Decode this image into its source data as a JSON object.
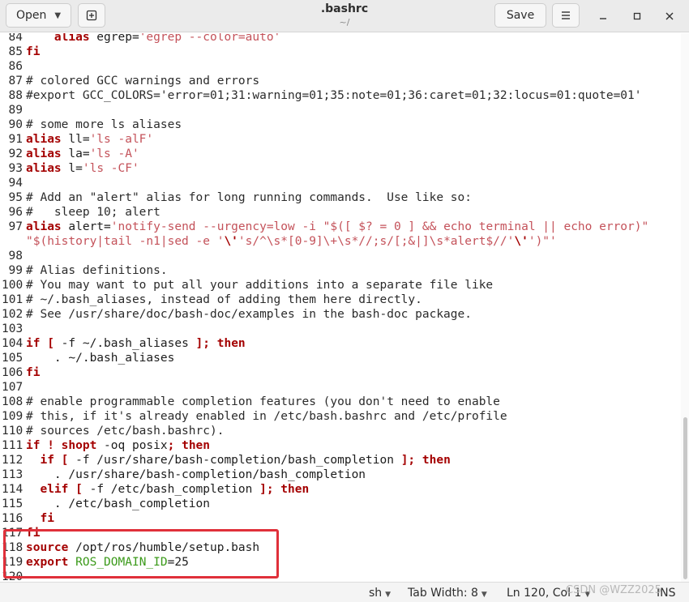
{
  "header": {
    "open_label": "Open",
    "save_label": "Save",
    "title": ".bashrc",
    "subtitle": "~/"
  },
  "editor": {
    "lines": [
      {
        "n": "84",
        "tokens": [
          {
            "t": "    "
          },
          {
            "t": "alias",
            "c": "kw"
          },
          {
            "t": " egrep="
          },
          {
            "t": "'egrep --color=auto'",
            "c": "str"
          }
        ]
      },
      {
        "n": "85",
        "tokens": [
          {
            "t": "fi",
            "c": "kw"
          }
        ]
      },
      {
        "n": "86",
        "tokens": []
      },
      {
        "n": "87",
        "tokens": [
          {
            "t": "# colored GCC warnings and errors",
            "c": "cmt"
          }
        ]
      },
      {
        "n": "88",
        "tokens": [
          {
            "t": "#export GCC_COLORS='error=01;31:warning=01;35:note=01;36:caret=01;32:locus=01:quote=01'",
            "c": "cmt"
          }
        ]
      },
      {
        "n": "89",
        "tokens": []
      },
      {
        "n": "90",
        "tokens": [
          {
            "t": "# some more ls aliases",
            "c": "cmt"
          }
        ]
      },
      {
        "n": "91",
        "tokens": [
          {
            "t": "alias",
            "c": "kw"
          },
          {
            "t": " ll="
          },
          {
            "t": "'ls -alF'",
            "c": "str"
          }
        ]
      },
      {
        "n": "92",
        "tokens": [
          {
            "t": "alias",
            "c": "kw"
          },
          {
            "t": " la="
          },
          {
            "t": "'ls -A'",
            "c": "str"
          }
        ]
      },
      {
        "n": "93",
        "tokens": [
          {
            "t": "alias",
            "c": "kw"
          },
          {
            "t": " l="
          },
          {
            "t": "'ls -CF'",
            "c": "str"
          }
        ]
      },
      {
        "n": "94",
        "tokens": []
      },
      {
        "n": "95",
        "tokens": [
          {
            "t": "# Add an \"alert\" alias for long running commands.  Use like so:",
            "c": "cmt"
          }
        ]
      },
      {
        "n": "96",
        "tokens": [
          {
            "t": "#   sleep 10; alert",
            "c": "cmt"
          }
        ]
      },
      {
        "n": "97",
        "tokens": [
          {
            "t": "alias",
            "c": "kw"
          },
          {
            "t": " alert="
          },
          {
            "t": "'notify-send --urgency=low -i \"$([ $? = 0 ] && echo terminal || echo error)\"",
            "c": "str"
          }
        ]
      },
      {
        "n": "",
        "tokens": [
          {
            "t": "\"$(history|tail -n1|sed -e '",
            "c": "str"
          },
          {
            "t": "\\'",
            "c": "kw"
          },
          {
            "t": "'s/^\\s*[0-9]\\+\\s*//;s/[;&|]\\s*alert$//'",
            "c": "str"
          },
          {
            "t": "\\'",
            "c": "kw"
          },
          {
            "t": "')\"'",
            "c": "str"
          }
        ]
      },
      {
        "n": "98",
        "tokens": []
      },
      {
        "n": "99",
        "tokens": [
          {
            "t": "# Alias definitions.",
            "c": "cmt"
          }
        ]
      },
      {
        "n": "100",
        "tokens": [
          {
            "t": "# You may want to put all your additions into a separate file like",
            "c": "cmt"
          }
        ]
      },
      {
        "n": "101",
        "tokens": [
          {
            "t": "# ~/.bash_aliases, instead of adding them here directly.",
            "c": "cmt"
          }
        ]
      },
      {
        "n": "102",
        "tokens": [
          {
            "t": "# See /usr/share/doc/bash-doc/examples in the bash-doc package.",
            "c": "cmt"
          }
        ]
      },
      {
        "n": "103",
        "tokens": []
      },
      {
        "n": "104",
        "tokens": [
          {
            "t": "if",
            "c": "kw"
          },
          {
            "t": " [ ",
            "c": "kw"
          },
          {
            "t": "-f ~/.bash_aliases "
          },
          {
            "t": "]; then",
            "c": "kw"
          }
        ]
      },
      {
        "n": "105",
        "tokens": [
          {
            "t": "    . ~/.bash_aliases"
          }
        ]
      },
      {
        "n": "106",
        "tokens": [
          {
            "t": "fi",
            "c": "kw"
          }
        ]
      },
      {
        "n": "107",
        "tokens": []
      },
      {
        "n": "108",
        "tokens": [
          {
            "t": "# enable programmable completion features (you don't need to enable",
            "c": "cmt"
          }
        ]
      },
      {
        "n": "109",
        "tokens": [
          {
            "t": "# this, if it's already enabled in /etc/bash.bashrc and /etc/profile",
            "c": "cmt"
          }
        ]
      },
      {
        "n": "110",
        "tokens": [
          {
            "t": "# sources /etc/bash.bashrc).",
            "c": "cmt"
          }
        ]
      },
      {
        "n": "111",
        "tokens": [
          {
            "t": "if ! shopt",
            "c": "kw"
          },
          {
            "t": " -oq posix"
          },
          {
            "t": "; then",
            "c": "kw"
          }
        ]
      },
      {
        "n": "112",
        "tokens": [
          {
            "t": "  "
          },
          {
            "t": "if [",
            "c": "kw"
          },
          {
            "t": " -f /usr/share/bash-completion/bash_completion "
          },
          {
            "t": "]; then",
            "c": "kw"
          }
        ]
      },
      {
        "n": "113",
        "tokens": [
          {
            "t": "    . /usr/share/bash-completion/bash_completion"
          }
        ]
      },
      {
        "n": "114",
        "tokens": [
          {
            "t": "  "
          },
          {
            "t": "elif [",
            "c": "kw"
          },
          {
            "t": " -f /etc/bash_completion "
          },
          {
            "t": "]; then",
            "c": "kw"
          }
        ]
      },
      {
        "n": "115",
        "tokens": [
          {
            "t": "    . /etc/bash_completion"
          }
        ]
      },
      {
        "n": "116",
        "tokens": [
          {
            "t": "  "
          },
          {
            "t": "fi",
            "c": "kw"
          }
        ]
      },
      {
        "n": "117",
        "tokens": [
          {
            "t": "fi",
            "c": "kw"
          }
        ]
      },
      {
        "n": "118",
        "tokens": [
          {
            "t": "source",
            "c": "kw"
          },
          {
            "t": " /opt/ros/humble/setup.bash"
          }
        ]
      },
      {
        "n": "119",
        "tokens": [
          {
            "t": "export",
            "c": "kw"
          },
          {
            "t": " "
          },
          {
            "t": "ROS_DOMAIN_ID",
            "c": "var"
          },
          {
            "t": "=25"
          }
        ]
      },
      {
        "n": "120",
        "tokens": []
      }
    ]
  },
  "statusbar": {
    "language": "sh",
    "tab_width": "Tab Width: 8",
    "position": "Ln 120, Col 1",
    "mode": "INS"
  },
  "watermark": "CSDN @WZZ2025",
  "colors": {
    "keyword": "#a40000",
    "string": "#c4525a",
    "variable": "#3b9a1a",
    "highlight_box": "#e0303a"
  }
}
